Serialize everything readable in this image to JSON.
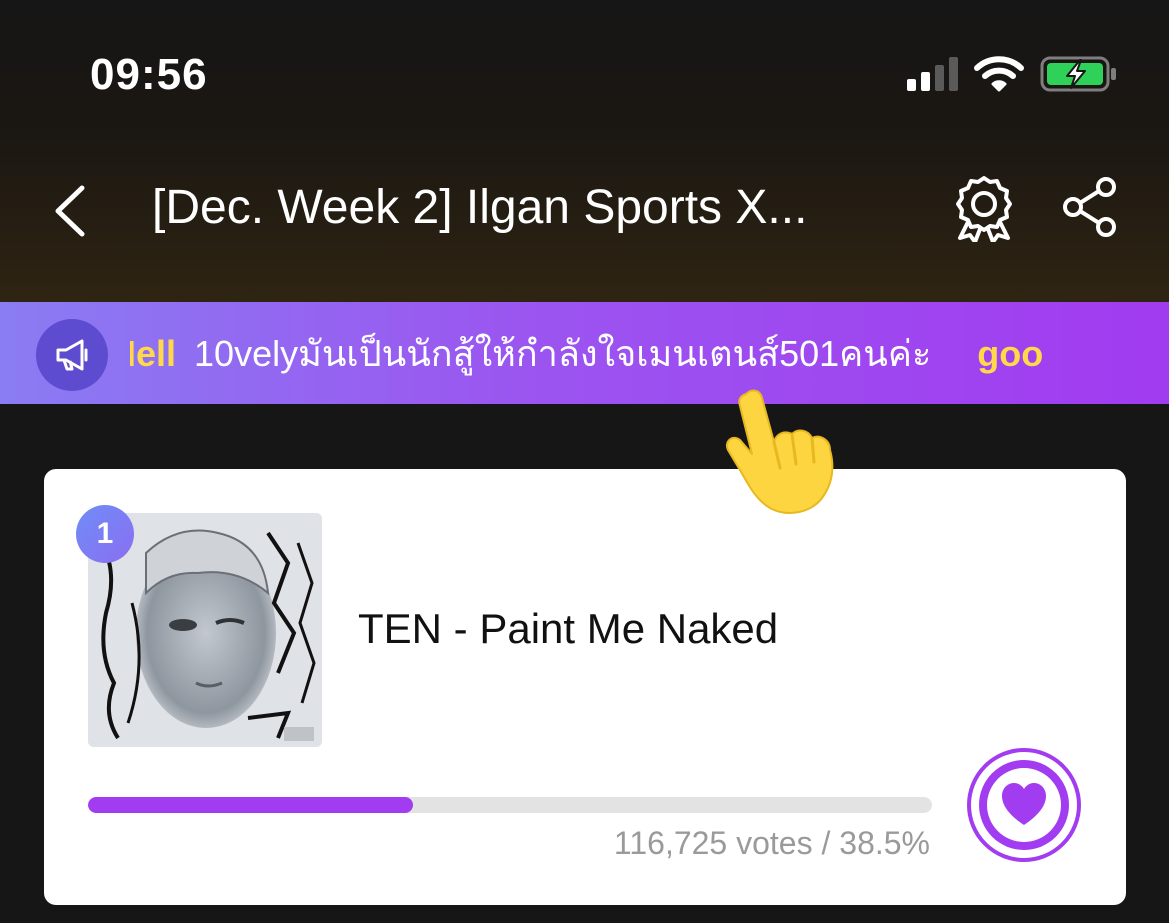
{
  "status_bar": {
    "time": "09:56",
    "signal_icon": "cellular-signal-icon",
    "wifi_icon": "wifi-icon",
    "battery_icon": "battery-charging-icon"
  },
  "header": {
    "title": "[Dec. Week 2] Ilgan Sports X...",
    "back_icon": "chevron-left-icon",
    "award_icon": "award-badge-icon",
    "share_icon": "share-icon"
  },
  "notice": {
    "icon": "megaphone-icon",
    "items": [
      {
        "user": "Hell",
        "message": "10velyมันเป็นนักสู้ให้กำลังใจเมนเตนส์501คนค่ะ"
      },
      {
        "user": "goo",
        "message": ""
      }
    ]
  },
  "card": {
    "rank": "1",
    "song_title": "TEN - Paint Me Naked",
    "votes_text": "116,725 votes / 38.5%",
    "vote_share_percent": 38.5,
    "vote_icon": "heart-icon"
  },
  "colors": {
    "accent_purple": "#a23cf0",
    "ticker_user": "#ffd94a",
    "banner_start": "#8a7cf2",
    "banner_end": "#a13bf0"
  }
}
